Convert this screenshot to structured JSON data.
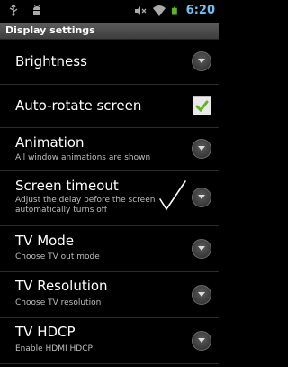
{
  "status_bar": {
    "time": "6:20",
    "icons": [
      "usb-icon",
      "android-debug-icon",
      "volume-muted-icon",
      "wifi-icon",
      "battery-icon"
    ]
  },
  "title_bar": {
    "title": "Display settings"
  },
  "settings": [
    {
      "title": "Brightness",
      "summary": "",
      "control": "chevron"
    },
    {
      "title": "Auto-rotate screen",
      "summary": "",
      "control": "checkbox",
      "checked": true
    },
    {
      "title": "Animation",
      "summary": "All window animations are shown",
      "control": "chevron"
    },
    {
      "title": "Screen timeout",
      "summary": "Adjust the delay before the screen automatically turns off",
      "control": "chevron"
    },
    {
      "title": "TV Mode",
      "summary": "Choose TV out mode",
      "control": "chevron"
    },
    {
      "title": "TV Resolution",
      "summary": "Choose TV resolution",
      "control": "chevron"
    },
    {
      "title": "TV HDCP",
      "summary": "Enable HDMI HDCP",
      "control": "chevron"
    }
  ],
  "colors": {
    "background": "#000000",
    "title_bar": "#4a4a4a",
    "clock": "#6ec1f0",
    "checkmark": "#5fb51f"
  }
}
